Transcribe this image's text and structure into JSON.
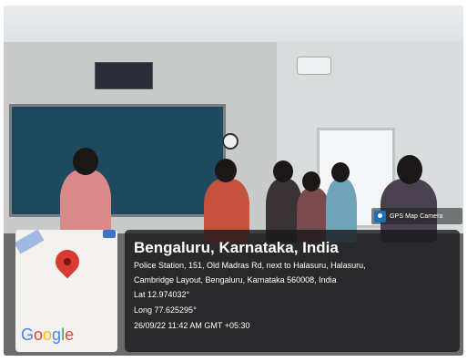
{
  "camera_app": {
    "label": "GPS Map Camera",
    "icon": "camera-icon"
  },
  "map": {
    "brand": {
      "letters": [
        {
          "char": "G",
          "color": "#4285f4"
        },
        {
          "char": "o",
          "color": "#ea4335"
        },
        {
          "char": "o",
          "color": "#fbbc05"
        },
        {
          "char": "g",
          "color": "#4285f4"
        },
        {
          "char": "l",
          "color": "#34a853"
        },
        {
          "char": "e",
          "color": "#ea4335"
        }
      ]
    },
    "marker_icon": "map-pin-icon"
  },
  "location": {
    "title": "Bengaluru, Karnataka, India",
    "address_line1": "Police Station, 151, Old Madras Rd, next to Halasuru, Halasuru,",
    "address_line2": "Cambridge Layout, Bengaluru, Karnataka 560008, India",
    "latitude": "Lat 12.974032°",
    "longitude": "Long 77.625295°",
    "timestamp": "26/09/22 11:42 AM GMT +05:30"
  }
}
